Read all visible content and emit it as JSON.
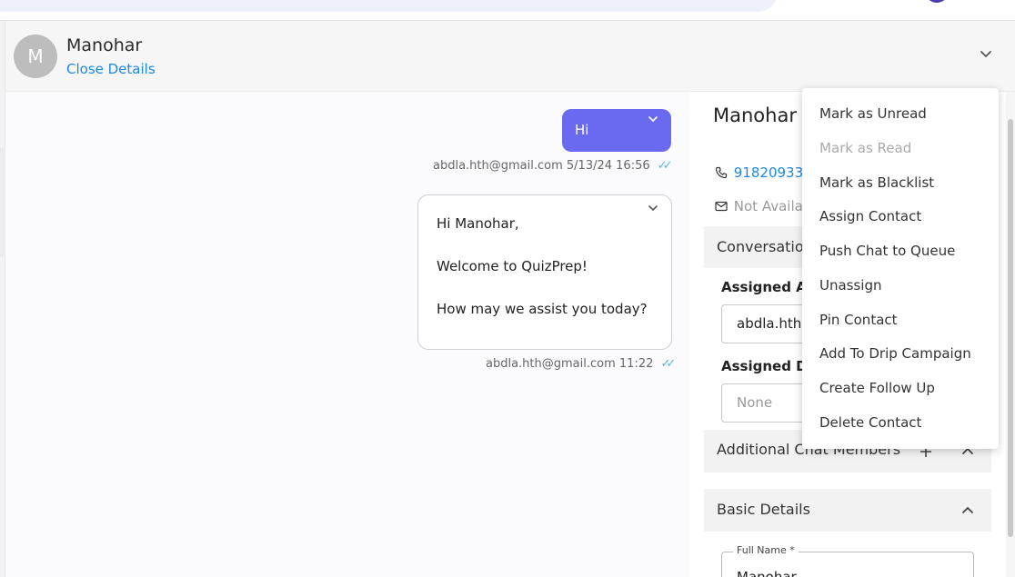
{
  "header": {
    "avatar_initial": "M",
    "contact_name": "Manohar",
    "close_details": "Close Details"
  },
  "messages": [
    {
      "direction": "out",
      "text": "Hi",
      "sender": "abdla.hth@gmail.com",
      "timestamp": "5/13/24 16:56"
    },
    {
      "direction": "out",
      "lines": [
        "Hi Manohar,",
        "Welcome to QuizPrep!",
        "How may we assist you today?"
      ],
      "sender": "abdla.hth@gmail.com",
      "timestamp": "11:22"
    }
  ],
  "details": {
    "name": "Manohar",
    "phone": "91820933",
    "email": "Not Availa",
    "conversation_section": "Conversatio",
    "assigned_agent_label": "Assigned A",
    "assigned_agent_value": "abdla.hth",
    "assigned_dept_label": "Assigned D",
    "assigned_dept_value": "None",
    "additional_members": "Additional Chat Members",
    "basic_details": "Basic Details",
    "full_name_label": "Full Name *",
    "full_name_value": "Manohar"
  },
  "menu": {
    "items": [
      {
        "label": "Mark as Unread",
        "disabled": false
      },
      {
        "label": "Mark as Read",
        "disabled": true
      },
      {
        "label": "Mark as Blacklist",
        "disabled": false
      },
      {
        "label": "Assign Contact",
        "disabled": false
      },
      {
        "label": "Push Chat to Queue",
        "disabled": false
      },
      {
        "label": "Unassign",
        "disabled": false
      },
      {
        "label": "Pin Contact",
        "disabled": false
      },
      {
        "label": "Add To Drip Campaign",
        "disabled": false
      },
      {
        "label": "Create Follow Up",
        "disabled": false
      },
      {
        "label": "Delete Contact",
        "disabled": false
      }
    ]
  },
  "colors": {
    "accent": "#1e88e5",
    "outgoing_bubble": "#6a6af0",
    "read_ticks": "#5ab4e8"
  },
  "icons": {
    "collapse": "chevron-down-icon",
    "message_menu": "chevron-down-icon",
    "phone": "phone-icon",
    "email": "mail-icon",
    "add_member": "plus-icon",
    "section_toggle": "chevron-up-icon",
    "read_receipt": "double-check-icon"
  }
}
